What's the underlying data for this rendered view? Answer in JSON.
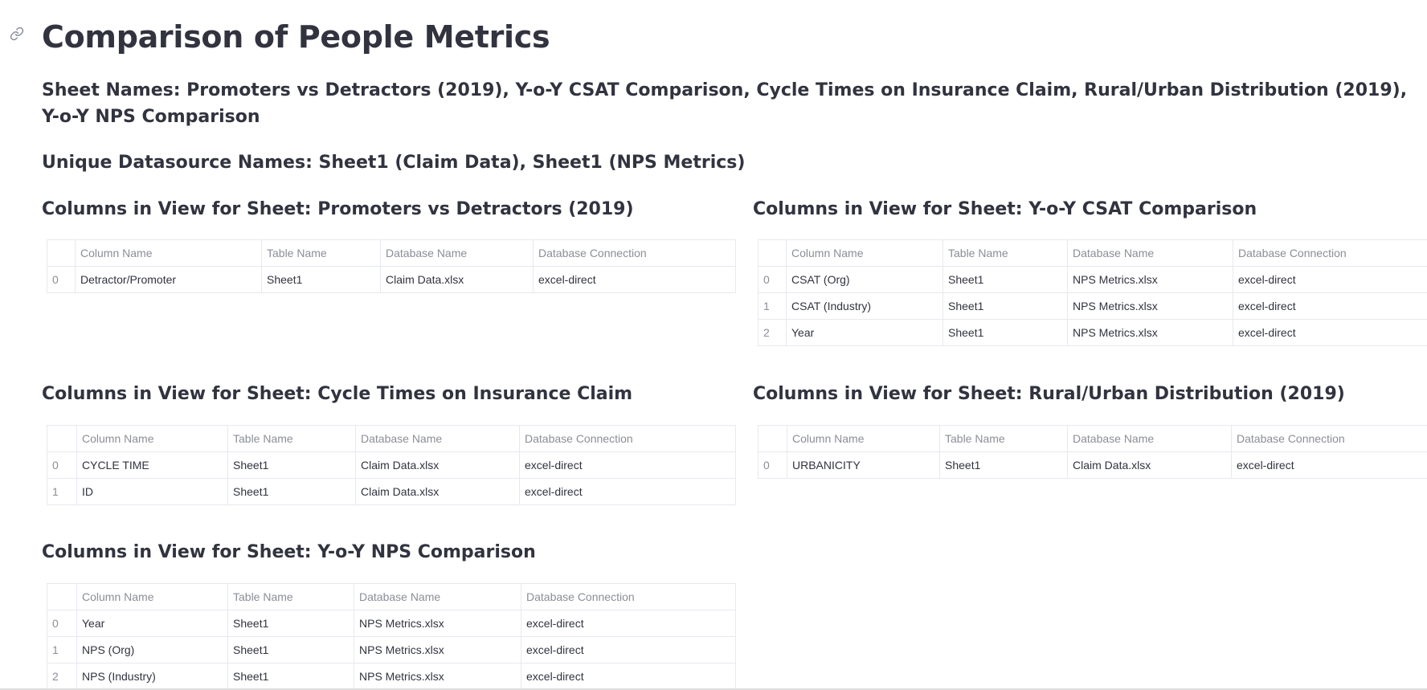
{
  "page": {
    "title": "Comparison of People Metrics",
    "sheet_names": "Sheet Names: Promoters vs Detractors (2019), Y-o-Y CSAT Comparison, Cycle Times on Insurance Claim, Rural/Urban Distribution (2019), Y-o-Y NPS Comparison",
    "datasource_names": "Unique Datasource Names: Sheet1 (Claim Data), Sheet1 (NPS Metrics)",
    "anchor_icon": "link-icon"
  },
  "columns": [
    "",
    "Column Name",
    "Table Name",
    "Database Name",
    "Database Connection"
  ],
  "sections": [
    {
      "title": "Columns in View for Sheet: Promoters vs Detractors (2019)",
      "rows": [
        [
          "0",
          "Detractor/Promoter",
          "Sheet1",
          "Claim Data.xlsx",
          "excel-direct"
        ]
      ]
    },
    {
      "title": "Columns in View for Sheet: Y-o-Y CSAT Comparison",
      "rows": [
        [
          "0",
          "CSAT (Org)",
          "Sheet1",
          "NPS Metrics.xlsx",
          "excel-direct"
        ],
        [
          "1",
          "CSAT (Industry)",
          "Sheet1",
          "NPS Metrics.xlsx",
          "excel-direct"
        ],
        [
          "2",
          "Year",
          "Sheet1",
          "NPS Metrics.xlsx",
          "excel-direct"
        ]
      ]
    },
    {
      "title": "Columns in View for Sheet: Cycle Times on Insurance Claim",
      "rows": [
        [
          "0",
          "CYCLE TIME",
          "Sheet1",
          "Claim Data.xlsx",
          "excel-direct"
        ],
        [
          "1",
          "ID",
          "Sheet1",
          "Claim Data.xlsx",
          "excel-direct"
        ]
      ]
    },
    {
      "title": "Columns in View for Sheet: Rural/Urban Distribution (2019)",
      "rows": [
        [
          "0",
          "URBANICITY",
          "Sheet1",
          "Claim Data.xlsx",
          "excel-direct"
        ]
      ]
    },
    {
      "title": "Columns in View for Sheet: Y-o-Y NPS Comparison",
      "rows": [
        [
          "0",
          "Year",
          "Sheet1",
          "NPS Metrics.xlsx",
          "excel-direct"
        ],
        [
          "1",
          "NPS (Org)",
          "Sheet1",
          "NPS Metrics.xlsx",
          "excel-direct"
        ],
        [
          "2",
          "NPS (Industry)",
          "Sheet1",
          "NPS Metrics.xlsx",
          "excel-direct"
        ]
      ]
    }
  ]
}
